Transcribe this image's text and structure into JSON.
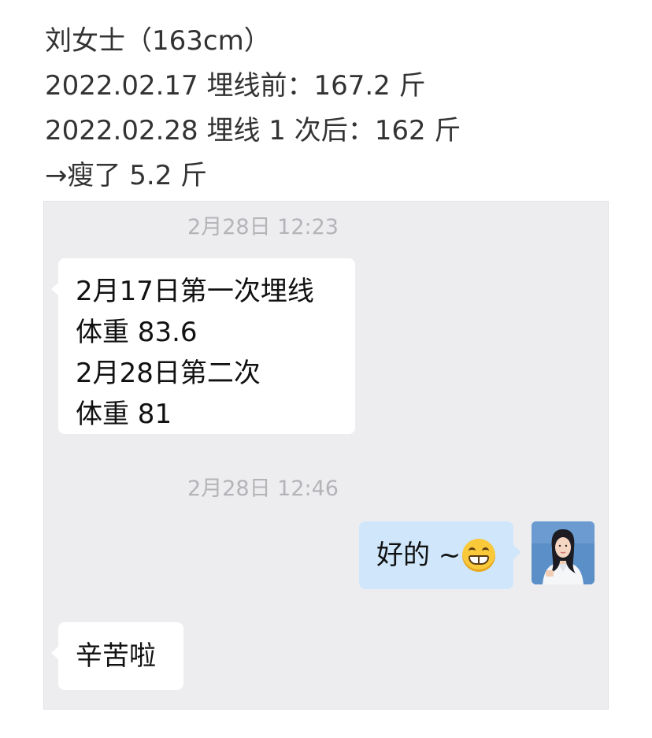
{
  "caption": {
    "lines": [
      "刘女士（163cm）",
      "2022.02.17 埋线前：167.2 斤",
      "2022.02.28 埋线 1 次后：162 斤",
      "→瘦了 5.2 斤"
    ]
  },
  "chat": {
    "timestamps": [
      "2月28日 12:23",
      "2月28日 12:46"
    ],
    "messages": [
      {
        "side": "left",
        "lines": [
          "2月17日第一次埋线",
          "体重 83.6",
          "2月28日第二次",
          "体重 81"
        ]
      },
      {
        "side": "right",
        "text": "好的 ~",
        "emoji": "grinning-face-emoji"
      },
      {
        "side": "left",
        "text": "辛苦啦"
      }
    ],
    "colors": {
      "background": "#ededf0",
      "left_bubble": "#ffffff",
      "right_bubble": "#cfe6fb",
      "timestamp": "#b4b4b8"
    }
  }
}
